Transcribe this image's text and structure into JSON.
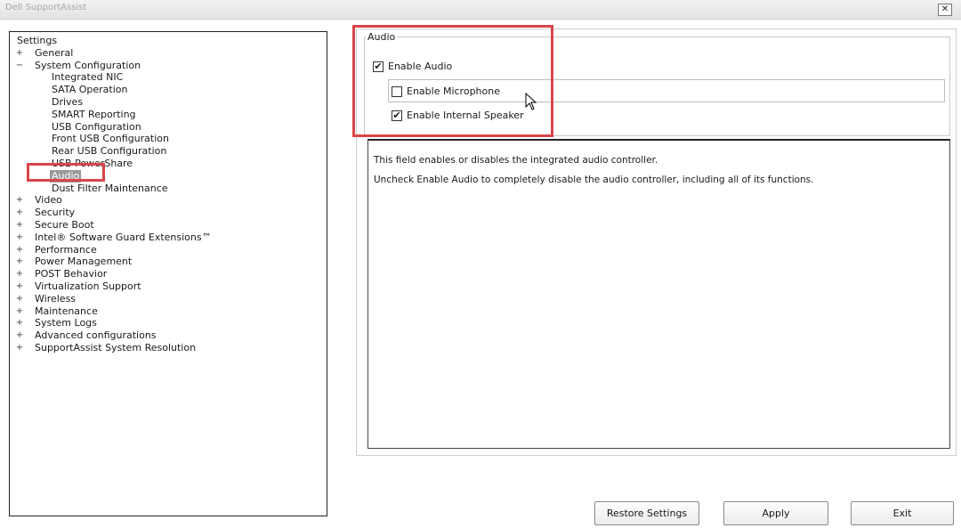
{
  "window": {
    "title": "Dell SupportAssist",
    "close_label": "✕"
  },
  "tree": {
    "items": [
      {
        "label": "Settings",
        "expander": "",
        "level": 0
      },
      {
        "label": "General",
        "expander": "+",
        "level": 1
      },
      {
        "label": "System Configuration",
        "expander": "−",
        "level": 1
      },
      {
        "label": "Integrated NIC",
        "expander": "",
        "level": 2
      },
      {
        "label": "SATA Operation",
        "expander": "",
        "level": 2
      },
      {
        "label": "Drives",
        "expander": "",
        "level": 2
      },
      {
        "label": "SMART Reporting",
        "expander": "",
        "level": 2
      },
      {
        "label": "USB Configuration",
        "expander": "",
        "level": 2
      },
      {
        "label": "Front USB Configuration",
        "expander": "",
        "level": 2
      },
      {
        "label": "Rear USB Configuration",
        "expander": "",
        "level": 2
      },
      {
        "label": "USB PowerShare",
        "expander": "",
        "level": 2
      },
      {
        "label": "Audio",
        "expander": "",
        "level": 2,
        "selected": true
      },
      {
        "label": "Dust Filter Maintenance",
        "expander": "",
        "level": 2
      },
      {
        "label": "Video",
        "expander": "+",
        "level": 1
      },
      {
        "label": "Security",
        "expander": "+",
        "level": 1
      },
      {
        "label": "Secure Boot",
        "expander": "+",
        "level": 1
      },
      {
        "label": "Intel® Software Guard Extensions™",
        "expander": "+",
        "level": 1
      },
      {
        "label": "Performance",
        "expander": "+",
        "level": 1
      },
      {
        "label": "Power Management",
        "expander": "+",
        "level": 1
      },
      {
        "label": "POST Behavior",
        "expander": "+",
        "level": 1
      },
      {
        "label": "Virtualization Support",
        "expander": "+",
        "level": 1
      },
      {
        "label": "Wireless",
        "expander": "+",
        "level": 1
      },
      {
        "label": "Maintenance",
        "expander": "+",
        "level": 1
      },
      {
        "label": "System Logs",
        "expander": "+",
        "level": 1
      },
      {
        "label": "Advanced configurations",
        "expander": "+",
        "level": 1
      },
      {
        "label": "SupportAssist System Resolution",
        "expander": "+",
        "level": 1
      }
    ]
  },
  "audio": {
    "group_title": "Audio",
    "enable_audio": {
      "label": "Enable Audio",
      "checked": true
    },
    "enable_microphone": {
      "label": "Enable Microphone",
      "checked": false
    },
    "enable_speaker": {
      "label": "Enable Internal Speaker",
      "checked": true
    }
  },
  "description": {
    "line1": "This field enables or disables the integrated audio controller.",
    "line2": "Uncheck Enable Audio to completely disable the audio controller, including all of its functions."
  },
  "buttons": {
    "restore": "Restore Settings",
    "apply": "Apply",
    "exit": "Exit"
  },
  "colors": {
    "highlight": "#d9454a",
    "selection": "#9a9a9a"
  },
  "icons": {
    "check": "check-icon",
    "close": "close-icon",
    "cursor": "mouse-cursor-icon"
  }
}
